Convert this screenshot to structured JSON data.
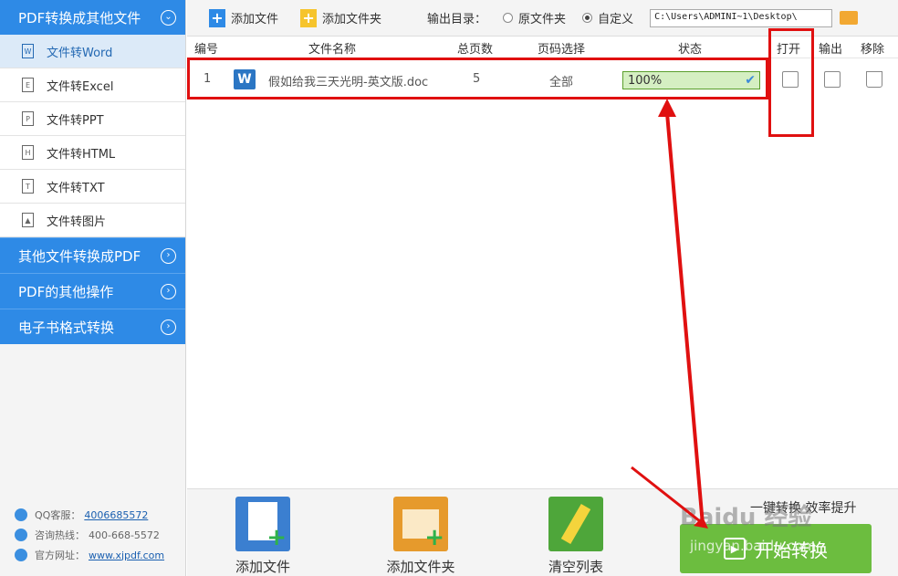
{
  "sidebar": {
    "header": "PDF转换成其他文件",
    "items": [
      {
        "label": "文件转Word",
        "icon": "W"
      },
      {
        "label": "文件转Excel",
        "icon": "E"
      },
      {
        "label": "文件转PPT",
        "icon": "P"
      },
      {
        "label": "文件转HTML",
        "icon": "H"
      },
      {
        "label": "文件转TXT",
        "icon": "T"
      },
      {
        "label": "文件转图片",
        "icon": ""
      }
    ],
    "sections": [
      "其他文件转换成PDF",
      "PDF的其他操作",
      "电子书格式转换"
    ],
    "footer": {
      "qq_label": "QQ客服：",
      "qq_value": "4006685572",
      "hotline_label": "咨询热线：",
      "hotline_value": "400-668-5572",
      "site_label": "官方网址：",
      "site_value": "www.xjpdf.com"
    }
  },
  "toolbar": {
    "add_file": "添加文件",
    "add_folder": "添加文件夹",
    "output_label": "输出目录：",
    "option_original": "原文件夹",
    "option_custom": "自定义",
    "output_path": "C:\\Users\\ADMINI~1\\Desktop\\"
  },
  "table": {
    "headers": {
      "no": "编号",
      "name": "文件名称",
      "pages": "总页数",
      "range": "页码选择",
      "status": "状态",
      "open": "打开",
      "output": "输出",
      "remove": "移除"
    },
    "rows": [
      {
        "no": "1",
        "name": "假如给我三天光明-英文版.doc",
        "pages": "5",
        "range": "全部",
        "progress": "100%"
      }
    ]
  },
  "bottom": {
    "add_file": "添加文件",
    "add_folder": "添加文件夹",
    "clear_list": "清空列表",
    "slogan": "一键转换  效率提升",
    "start": "开始转换"
  },
  "watermark": {
    "text1": "Baidu 经验",
    "text2": "jingyan.baidu.com"
  },
  "colors": {
    "accent": "#2e8ae6",
    "highlight": "#e01010",
    "start_button": "#6cbd3f"
  }
}
